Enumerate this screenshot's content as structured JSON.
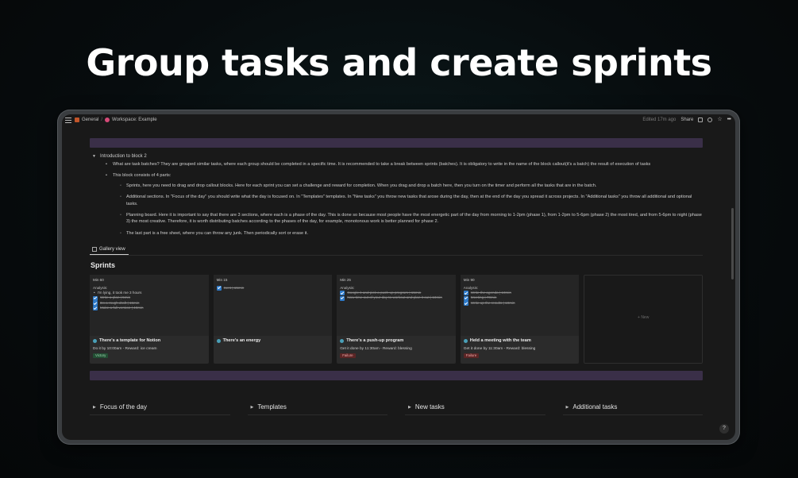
{
  "headline": "Group tasks and create sprints",
  "topbar": {
    "crumbs": [
      "General",
      "/",
      "Workspace: Example"
    ],
    "edited": "Edited 17m ago",
    "share": "Share"
  },
  "intro": {
    "toggle_label": "Introduction to block 2",
    "bullets": [
      "What are task batches? They are grouped similar tasks, where each group should be completed in a specific time. It is recommended to take a break between sprints (batches). It is obligatory to write in the name of the block callout(it's a batch) the result of execution of tasks",
      "This block consists of 4 parts:"
    ],
    "parts": [
      "Sprints, here you need to drag and drop callout blocks. Here for each sprint you can set a challenge and reward for completion. When you drag and drop a batch here, then you turn on the timer and perform all the tasks that are in the batch.",
      "Additional sections. In \"Focus of the day\" you should write what the day is focused on. In \"Templates\" templates. In \"New tasks\" you throw new tasks that arose during the day, then at the end of the day you spread it across projects. In \"Additional tasks\" you throw all additional and optional tasks.",
      "Planning board. Here it is important to say that there are 3 sections, where each is a phase of the day. This is done so because most people have the most energetic part of the day from morning to 1-2pm (phase 1), from 1-2pm to 5-6pm (phase 2) the most tired, and from 5-6pm to night (phase 3) the most creative. Therefore, it is worth distributing batches according to the phases of the day, for example, monotonous work is better planned for phase 2.",
      "The last part is a free sheet, where you can throw any junk. Then periodically sort or erase it."
    ]
  },
  "view_tab": "Gallery view",
  "sprints_title": "Sprints",
  "cards": [
    {
      "mins": "Min 60",
      "analysis": "Analysis:",
      "bullet": "I'm lying, it took me 3 hours",
      "checks": [
        "Write a plan | 5min",
        "Do a rough draft | 15min",
        "Make a full version | 40min"
      ],
      "title": "There's a template for Notion",
      "sub": "Do it by 10:00am - Reward: ice cream",
      "badge": "Victory",
      "badge_color": "green"
    },
    {
      "mins": "Min 15",
      "analysis": "",
      "bullet": "",
      "checks": [
        "Sent | 15min"
      ],
      "title": "There's an energy",
      "sub": "",
      "badge": "",
      "badge_color": ""
    },
    {
      "mins": "Min 25",
      "analysis": "Analysis:",
      "bullet": "",
      "checks": [
        "Google it and pick a push-up program | 15min",
        "Now time out of your day to workout and plan it out | 10min"
      ],
      "title": "There's a push-up program",
      "sub": "Get it done by 11:30am - Reward: blessing",
      "badge": "Failure",
      "badge_color": "red"
    },
    {
      "mins": "Min 90",
      "analysis": "Analysis:",
      "bullet": "",
      "checks": [
        "Write the agenda | 10min",
        "Meeting | 70min",
        "Write up the results | 10min"
      ],
      "title": "Held a meeting with the team",
      "sub": "Get it done by 11:30am - Reward: blessing",
      "badge": "Failure",
      "badge_color": "red"
    }
  ],
  "new_card": "+ New",
  "sections": [
    "Focus of the day",
    "Templates",
    "New tasks",
    "Additional tasks"
  ],
  "help": "?"
}
